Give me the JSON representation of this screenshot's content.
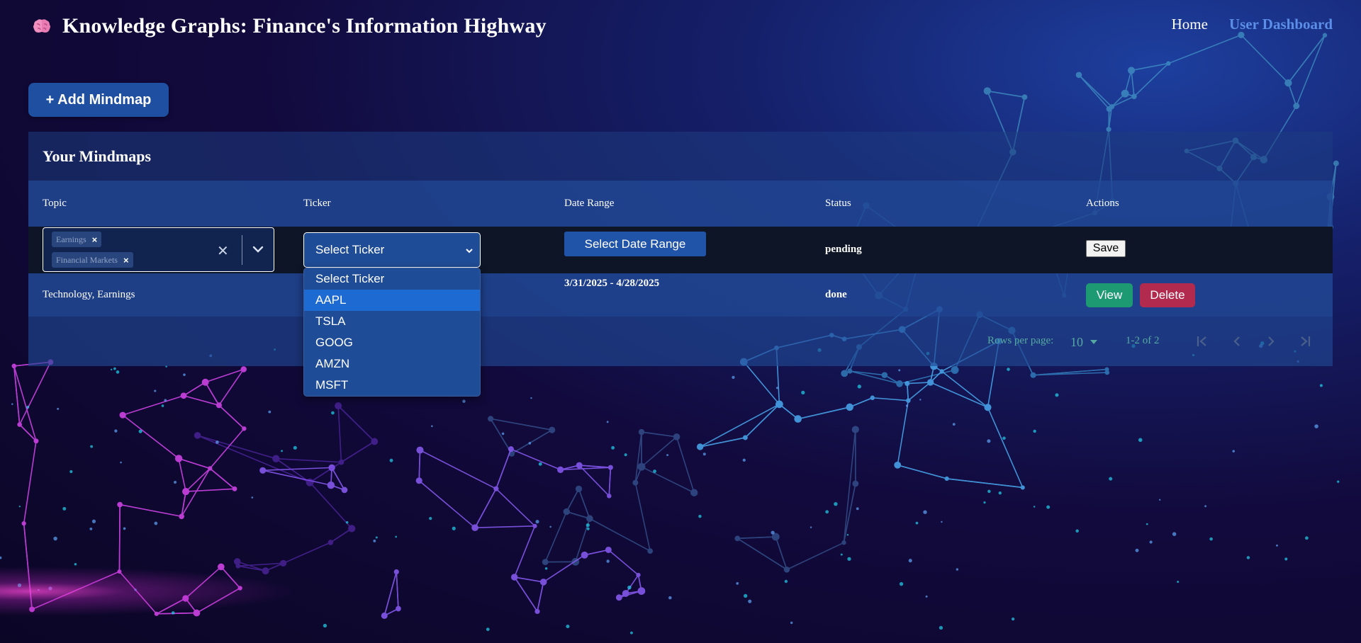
{
  "header": {
    "title": "Knowledge Graphs: Finance's Information Highway",
    "brand_icon": "brain-icon",
    "nav": {
      "home": "Home",
      "dashboard": "User Dashboard"
    },
    "active_color": "#5b8ee6"
  },
  "toolbar": {
    "add_label": "+ Add Mindmap"
  },
  "panel": {
    "title": "Your Mindmaps",
    "columns": {
      "topic": "Topic",
      "ticker": "Ticker",
      "date_range": "Date Range",
      "status": "Status",
      "actions": "Actions"
    }
  },
  "edit_row": {
    "topic_chips": [
      "Earnings",
      "Financial Markets"
    ],
    "ticker_value": "Select Ticker",
    "date_button": "Select Date Range",
    "status": "pending",
    "save_label": "Save"
  },
  "rows": [
    {
      "topic": "Technology, Earnings",
      "date_range": "3/31/2025 - 4/28/2025",
      "status": "done",
      "view_label": "View",
      "delete_label": "Delete"
    }
  ],
  "pagination": {
    "rows_per_page_label": "Rows per page:",
    "rows_per_page_value": "10",
    "range_text": "1-2 of 2"
  },
  "ticker_dropdown": {
    "options": [
      "Select Ticker",
      "AAPL",
      "TSLA",
      "GOOG",
      "AMZN",
      "MSFT"
    ],
    "highlighted": "AAPL"
  },
  "colors": {
    "view": "#1e9a72",
    "delete": "#b22a4e",
    "accent": "#1f4fa0"
  }
}
